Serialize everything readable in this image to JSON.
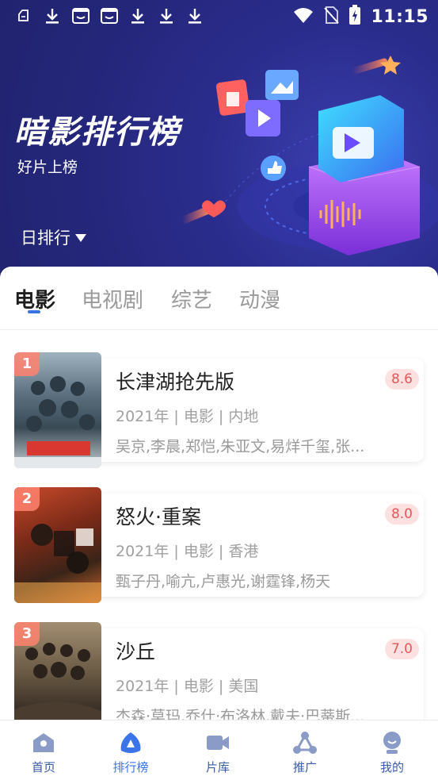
{
  "status_bar": {
    "time": "11:15",
    "left_icons": [
      "app-notification-icon",
      "download-icon",
      "tv-box-icon",
      "tv-box-icon",
      "download-icon",
      "download-icon",
      "download-icon"
    ],
    "right_icons": [
      "wifi-icon",
      "no-sim-icon",
      "battery-charging-icon"
    ]
  },
  "header": {
    "title": "暗影排行榜",
    "subtitle": "好片上榜",
    "period_selector": "日排行"
  },
  "tabs": [
    {
      "label": "电影",
      "active": true
    },
    {
      "label": "电视剧",
      "active": false
    },
    {
      "label": "综艺",
      "active": false
    },
    {
      "label": "动漫",
      "active": false
    }
  ],
  "movies": [
    {
      "rank": "1",
      "title": "长津湖抢先版",
      "score": "8.6",
      "meta": "2021年 | 电影 | 内地",
      "cast": "吴京,李晨,郑恺,朱亚文,易烊千玺,张..."
    },
    {
      "rank": "2",
      "title": "怒火·重案",
      "score": "8.0",
      "meta": "2021年 | 电影 |  香港",
      "cast": "甄子丹,喻亢,卢惠光,谢霆锋,杨天"
    },
    {
      "rank": "3",
      "title": "沙丘",
      "score": "7.0",
      "meta": "2021年 | 电影 | 美国",
      "cast": "杰森·莫玛,乔什·布洛林,戴夫·巴蒂斯..."
    }
  ],
  "bottom_nav": [
    {
      "label": "首页",
      "icon": "home-icon",
      "active": false
    },
    {
      "label": "排行榜",
      "icon": "ranking-icon",
      "active": true
    },
    {
      "label": "片库",
      "icon": "video-camera-icon",
      "active": false
    },
    {
      "label": "推广",
      "icon": "share-icon",
      "active": false
    },
    {
      "label": "我的",
      "icon": "profile-icon",
      "active": false
    }
  ],
  "colors": {
    "banner": "#24267a",
    "accent": "#3b74e8",
    "score_bg": "#fde1e1",
    "score_text": "#e05a5a",
    "nav_text": "#3a5ba8"
  }
}
